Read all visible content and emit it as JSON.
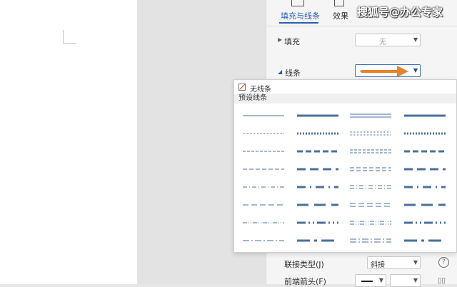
{
  "watermark": "搜狐号@办公专家",
  "tabs": [
    {
      "label": "填充与线条",
      "active": true
    },
    {
      "label": "效果",
      "active": false
    }
  ],
  "fill": {
    "label": "填充",
    "value": "无"
  },
  "line": {
    "label": "线条"
  },
  "popup": {
    "no_line": "无线条",
    "preset_header": "预设线条"
  },
  "join": {
    "label": "联接类型(J)",
    "value": "斜接"
  },
  "front_arrow": {
    "label": "前端箭头(F)"
  },
  "colors": {
    "accent": "#2a5fb0",
    "line": "#4a6f9c",
    "arrow": "#e5822b"
  },
  "icons": [
    "help-icon",
    "grid-icon",
    "dropdown-caret-icon",
    "arrow-icon",
    "no-line-icon"
  ],
  "presets": [
    {
      "width": 1,
      "dash": "solid",
      "double": false
    },
    {
      "width": 3,
      "dash": "solid",
      "double": false
    },
    {
      "width": 1,
      "dash": "solid",
      "double": true
    },
    {
      "width": 3,
      "dash": "solid",
      "double": false
    },
    {
      "width": 1,
      "dash": "dot",
      "double": false
    },
    {
      "width": 3,
      "dash": "dot",
      "double": false
    },
    {
      "width": 1,
      "dash": "dot",
      "double": true
    },
    {
      "width": 3,
      "dash": "dot",
      "double": false
    },
    {
      "width": 1,
      "dash": "dash",
      "double": false
    },
    {
      "width": 3,
      "dash": "dash",
      "double": false
    },
    {
      "width": 1,
      "dash": "dash",
      "double": true
    },
    {
      "width": 3,
      "dash": "dash",
      "double": false
    },
    {
      "width": 1,
      "dash": "longdash",
      "double": false
    },
    {
      "width": 3,
      "dash": "longdash",
      "double": false
    },
    {
      "width": 1,
      "dash": "longdash",
      "double": true
    },
    {
      "width": 3,
      "dash": "longdash",
      "double": false
    },
    {
      "width": 1,
      "dash": "dashdot",
      "double": false
    },
    {
      "width": 3,
      "dash": "dashdot",
      "double": false
    },
    {
      "width": 1,
      "dash": "dashdot",
      "double": true
    },
    {
      "width": 3,
      "dash": "dashdot",
      "double": false
    },
    {
      "width": 1,
      "dash": "longdash2",
      "double": false
    },
    {
      "width": 3,
      "dash": "longdash2",
      "double": false
    },
    {
      "width": 1,
      "dash": "longdash2",
      "double": true
    },
    {
      "width": 3,
      "dash": "longdash2",
      "double": false
    },
    {
      "width": 1,
      "dash": "dashdotdot",
      "double": false
    },
    {
      "width": 3,
      "dash": "dashdotdot",
      "double": false
    },
    {
      "width": 1,
      "dash": "dashdotdot",
      "double": true
    },
    {
      "width": 3,
      "dash": "dashdotdot",
      "double": false
    },
    {
      "width": 1,
      "dash": "longdashdot",
      "double": false
    },
    {
      "width": 3,
      "dash": "longdashdot",
      "double": false
    },
    {
      "width": 1,
      "dash": "longdashdot",
      "double": true
    },
    {
      "width": 3,
      "dash": "longdashdot",
      "double": false
    }
  ]
}
